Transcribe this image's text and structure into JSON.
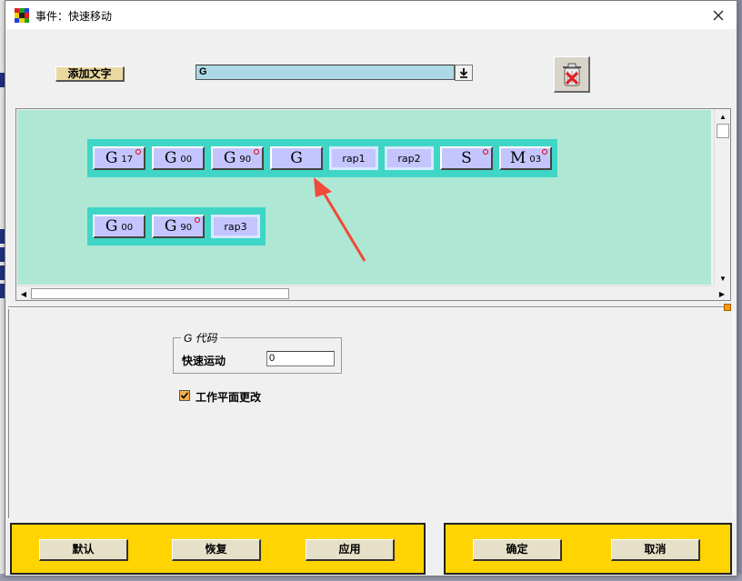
{
  "window": {
    "title": "事件：快速移动"
  },
  "toolbar": {
    "add_text_label": "添加文字",
    "gcode_value": "G"
  },
  "canvas": {
    "row1": [
      {
        "letter": "G",
        "sub": "17",
        "style": "raised",
        "marked": true
      },
      {
        "letter": "G",
        "sub": "00",
        "style": "raised",
        "marked": false
      },
      {
        "letter": "G",
        "sub": "90",
        "style": "raised",
        "marked": true
      },
      {
        "letter": "G",
        "sub": "",
        "style": "raised",
        "marked": false
      },
      {
        "letter": "rap1",
        "sub": "",
        "style": "flat",
        "marked": false
      },
      {
        "letter": "rap2",
        "sub": "",
        "style": "flat",
        "marked": false
      },
      {
        "letter": "S",
        "sub": "",
        "style": "raised",
        "marked": true
      },
      {
        "letter": "M",
        "sub": "03",
        "style": "raised",
        "marked": true
      }
    ],
    "row2": [
      {
        "letter": "G",
        "sub": "00",
        "style": "raised",
        "marked": false
      },
      {
        "letter": "G",
        "sub": "90",
        "style": "raised",
        "marked": true
      },
      {
        "letter": "rap3",
        "sub": "",
        "style": "flat",
        "marked": false
      }
    ]
  },
  "properties": {
    "group_title": "G 代码",
    "rapid_label": "快速运动",
    "rapid_value": "0",
    "plane_change_label": "工作平面更改",
    "plane_change_checked": true
  },
  "buttons": {
    "default": "默认",
    "restore": "恢复",
    "apply": "应用",
    "ok": "确定",
    "cancel": "取消"
  },
  "colors": {
    "canvas_bg": "#aee8d4",
    "strip_bg": "#3fd6c8",
    "token_bg": "#c4c4ff",
    "bar_yellow": "#ffd400",
    "annotation_arrow": "#f04a3a"
  }
}
